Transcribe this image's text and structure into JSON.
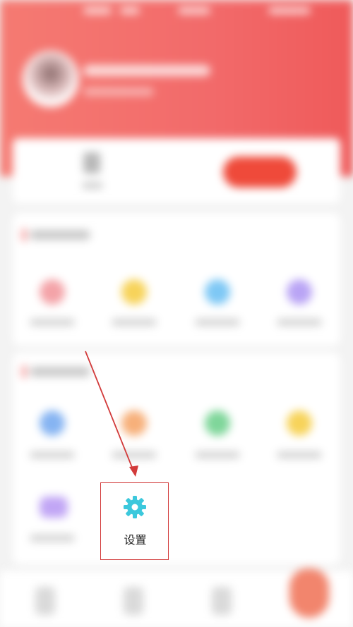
{
  "settings_tile": {
    "label": "设置",
    "icon": "gear-icon"
  },
  "colors": {
    "header_gradient_start": "#f57a72",
    "header_gradient_end": "#ef5a5a",
    "accent_red": "#ef4a3a",
    "annotation_red": "#d23a3a",
    "settings_icon": "#3cc8dc",
    "tile_colors_row1": [
      "#f4a3a8",
      "#f7d35a",
      "#7ec8f5",
      "#b9a4f5"
    ],
    "tile_colors_row2": [
      "#86b4f2",
      "#f7b07a",
      "#7fd69a",
      "#f7d35a"
    ],
    "tile_colors_row3": [
      "#c1a6f5"
    ]
  }
}
